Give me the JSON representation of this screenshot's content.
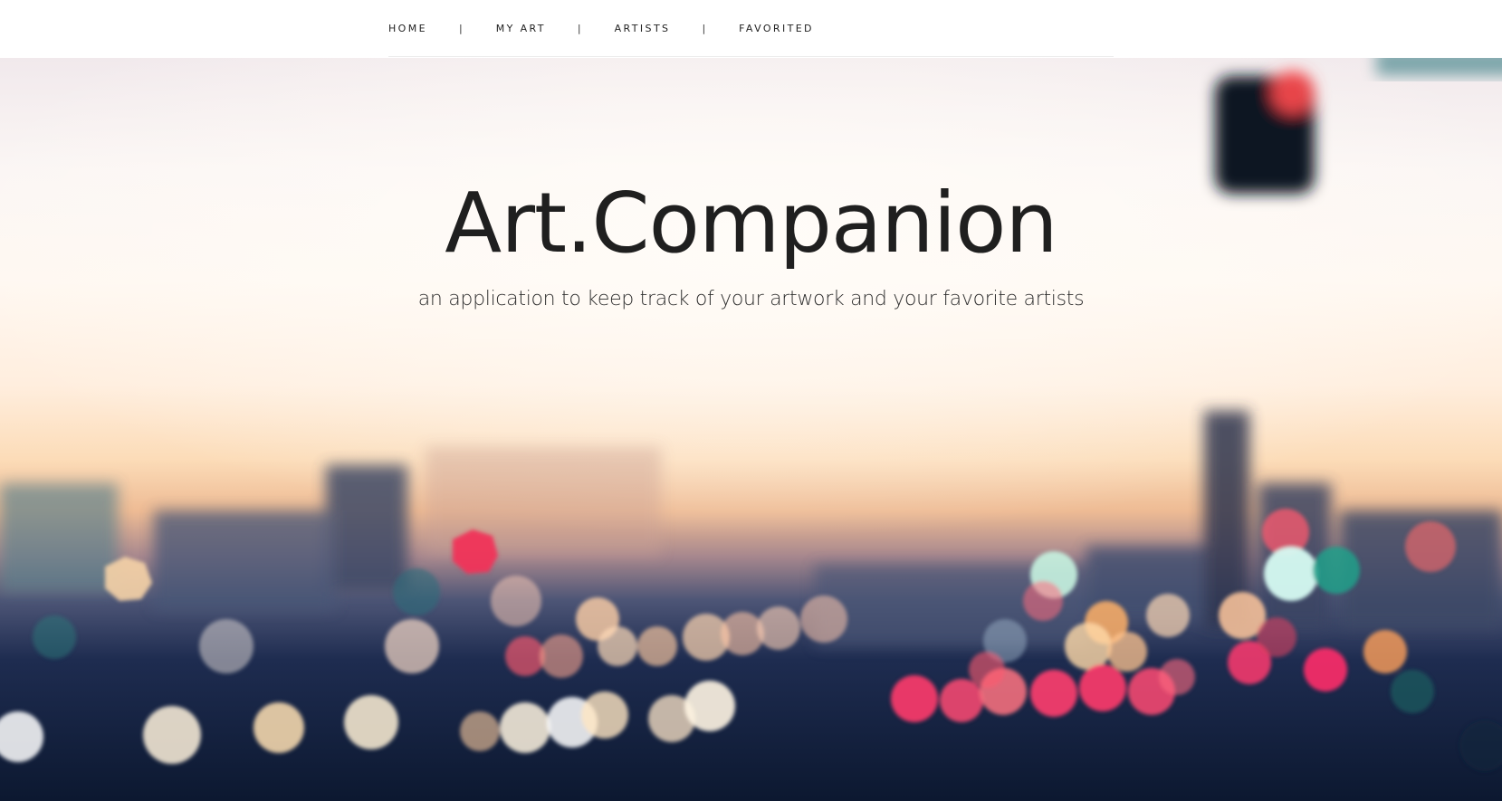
{
  "nav": {
    "items": [
      {
        "label": "HOME"
      },
      {
        "label": "MY ART"
      },
      {
        "label": "ARTISTS"
      },
      {
        "label": "FAVORITED"
      }
    ],
    "separator": "|"
  },
  "hero": {
    "title": "Art.Companion",
    "subtitle": "an application to keep track of your artwork and your favorite artists",
    "background": "blurred city bokeh at sunset"
  },
  "colors": {
    "text": "#1f1f1f",
    "nav_text": "#222222",
    "topbar_bg": "#ffffff"
  }
}
